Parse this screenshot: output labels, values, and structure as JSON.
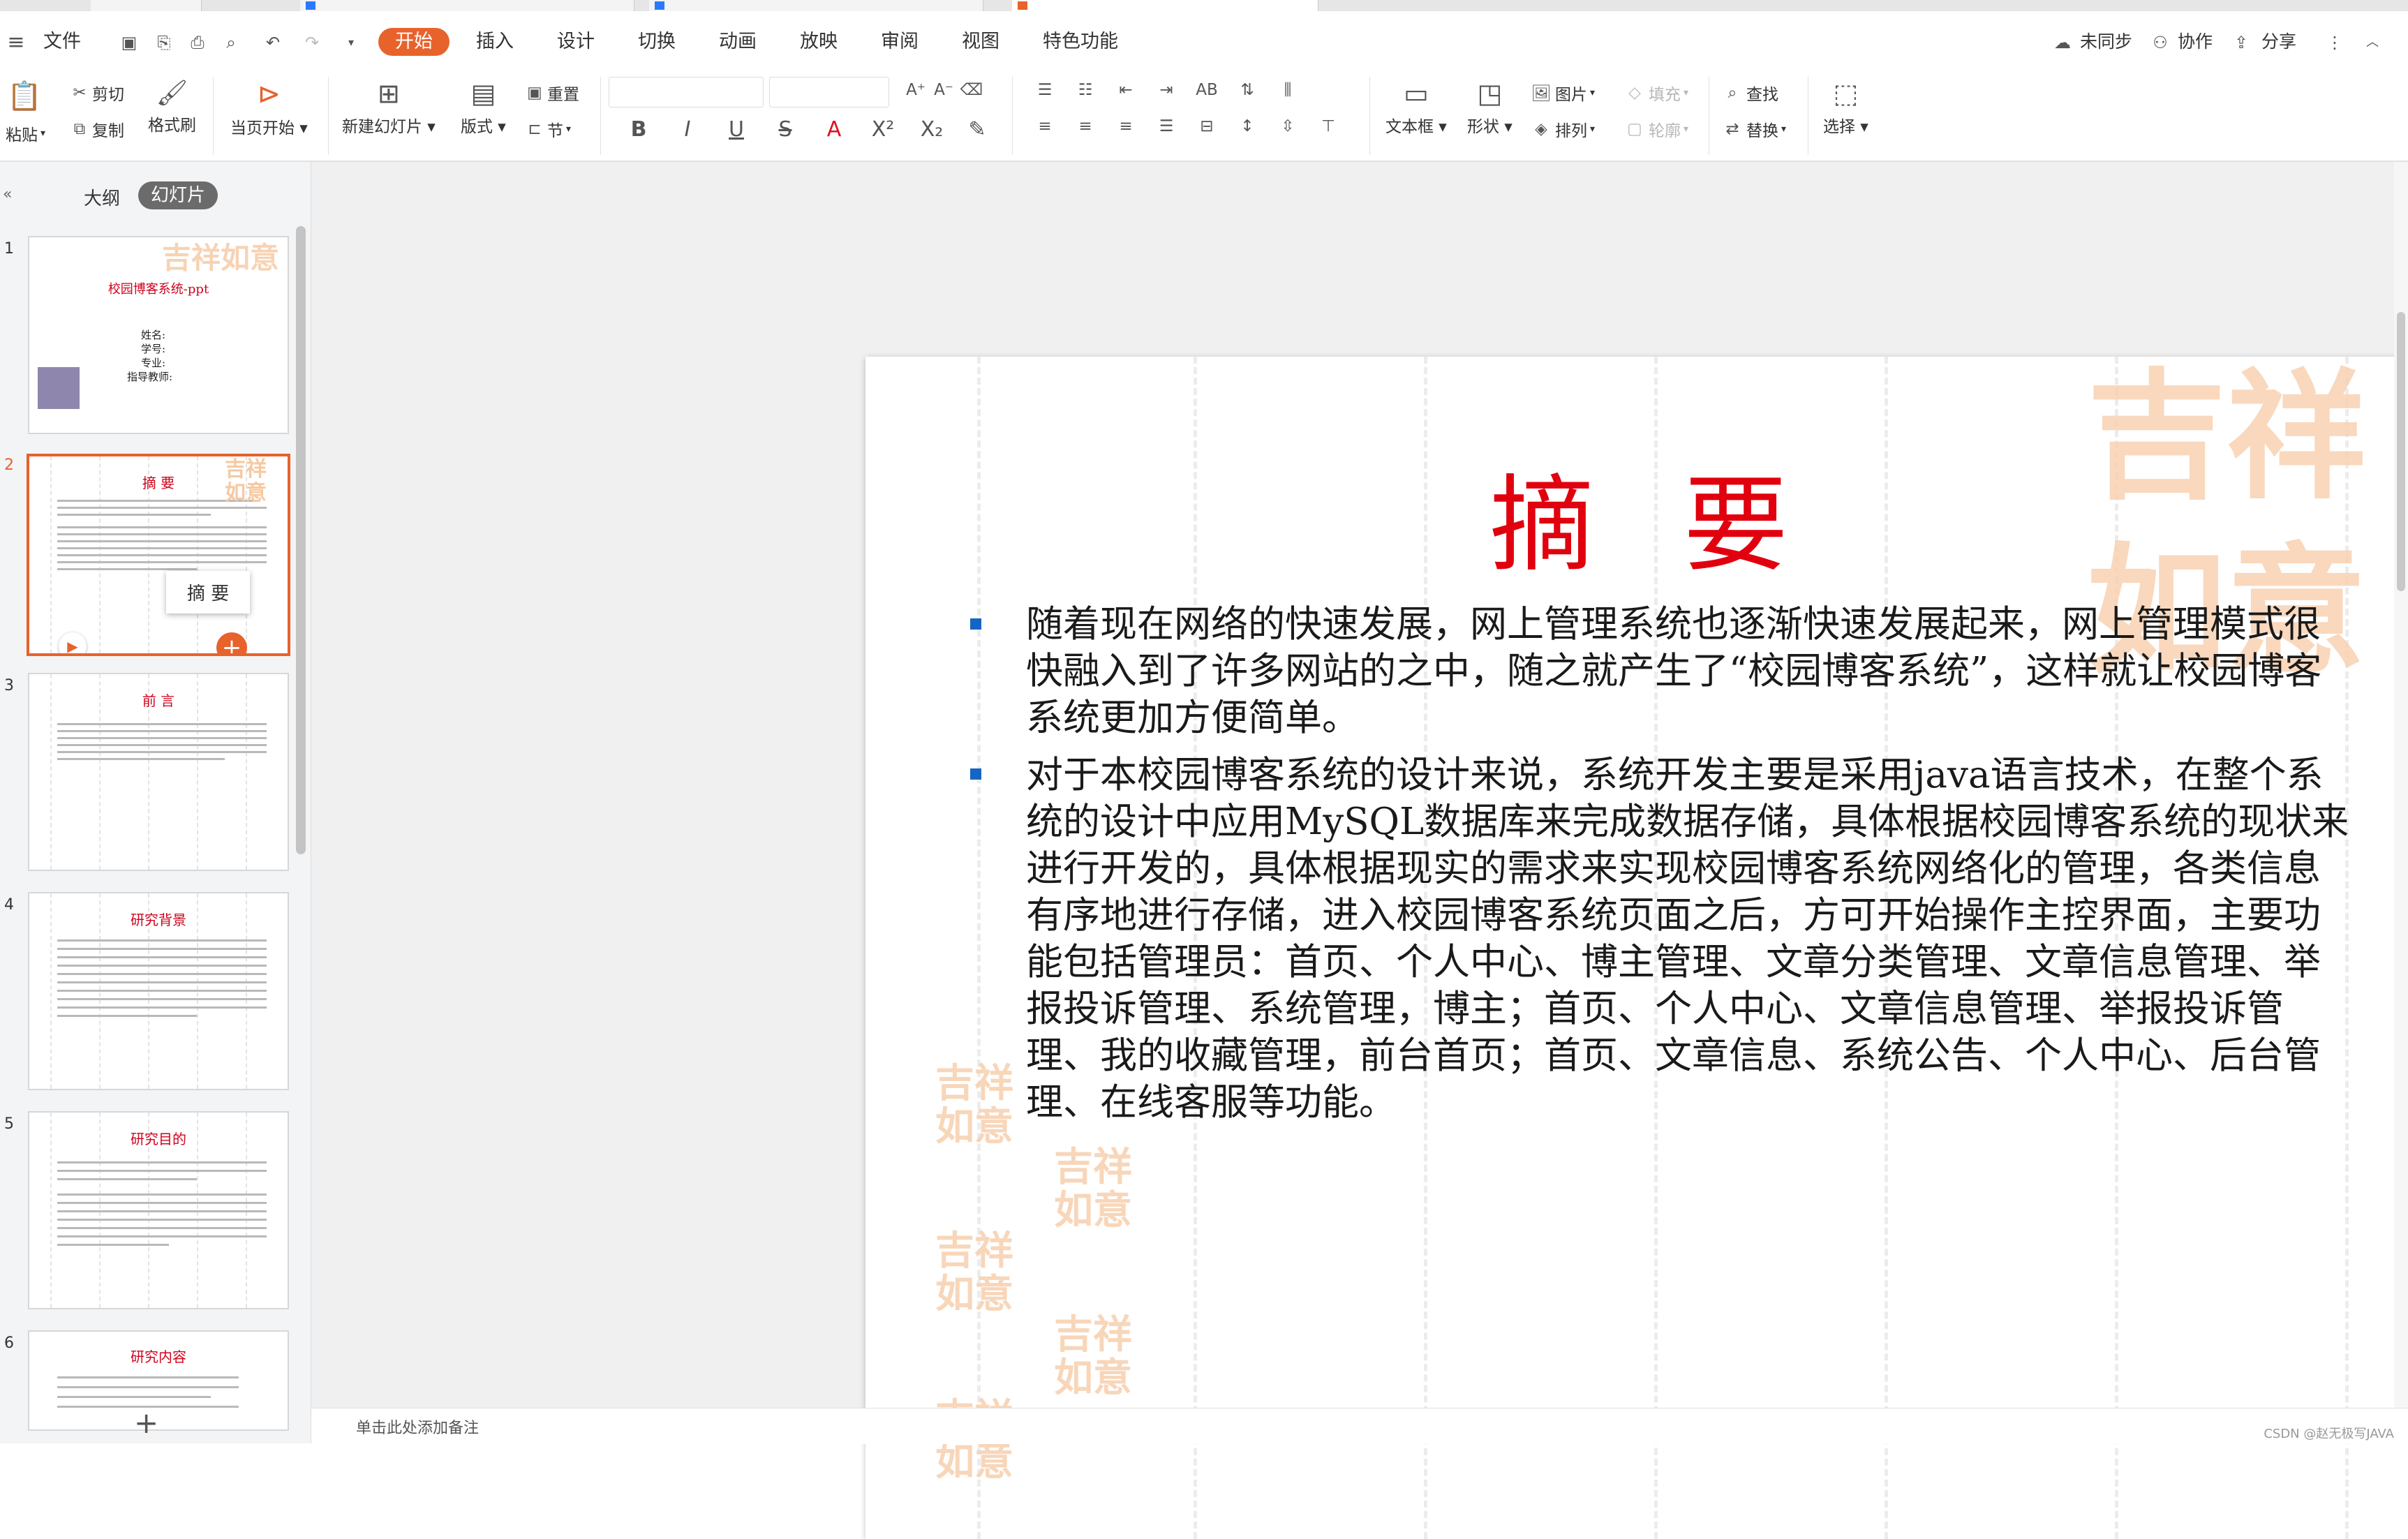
{
  "menu": {
    "file": "文件",
    "tabs": [
      "开始",
      "插入",
      "设计",
      "切换",
      "动画",
      "放映",
      "审阅",
      "视图",
      "特色功能"
    ],
    "sync": "未同步",
    "collab": "协作",
    "share": "分享"
  },
  "ribbon": {
    "paste": "粘贴",
    "cut": "剪切",
    "copy": "复制",
    "format_painter": "格式刷",
    "play_current": "当页开始",
    "new_slide": "新建幻灯片",
    "layout": "版式",
    "reset": "重置",
    "section": "节",
    "text_box": "文本框",
    "shape": "形状",
    "picture": "图片",
    "arrange": "排列",
    "fill": "填充",
    "outline": "轮廓",
    "find": "查找",
    "replace": "替换",
    "select": "选择"
  },
  "panel": {
    "outline_tab": "大纲",
    "slides_tab": "幻灯片",
    "tooltip": "摘 要",
    "thumbs": [
      {
        "num": "1",
        "title": "校园博客系统-ppt",
        "lines": [
          "姓名:",
          "学号:",
          "专业:",
          "指导教师:"
        ]
      },
      {
        "num": "2",
        "title": "摘 要"
      },
      {
        "num": "3",
        "title": "前 言"
      },
      {
        "num": "4",
        "title": "研究背景"
      },
      {
        "num": "5",
        "title": "研究目的"
      },
      {
        "num": "6",
        "title": "研究内容"
      }
    ]
  },
  "slide": {
    "title": "摘 要",
    "seal_text": "吉祥如意",
    "paragraphs": [
      "随着现在网络的快速发展，网上管理系统也逐渐快速发展起来，网上管理模式很快融入到了许多网站的之中，随之就产生了“校园博客系统”，这样就让校园博客系统更加方便简单。",
      "对于本校园博客系统的设计来说，系统开发主要是采用java语言技术，在整个系统的设计中应用MySQL数据库来完成数据存储，具体根据校园博客系统的现状来进行开发的，具体根据现实的需求来实现校园博客系统网络化的管理，各类信息有序地进行存储，进入校园博客系统页面之后，方可开始操作主控界面，主要功能包括管理员：首页、个人中心、博主管理、文章分类管理、文章信息管理、举报投诉管理、系统管理，博主；首页、个人中心、文章信息管理、举报投诉管理、我的收藏管理，前台首页；首页、文章信息、系统公告、个人中心、后台管理、在线客服等功能。"
    ]
  },
  "notes_placeholder": "单击此处添加备注",
  "watermark": "CSDN @赵无极写JAVA",
  "colors": {
    "accent": "#e8622c",
    "title_red": "#e1000e",
    "bullet_blue": "#1566c2",
    "seal": "#f8d2b2"
  }
}
